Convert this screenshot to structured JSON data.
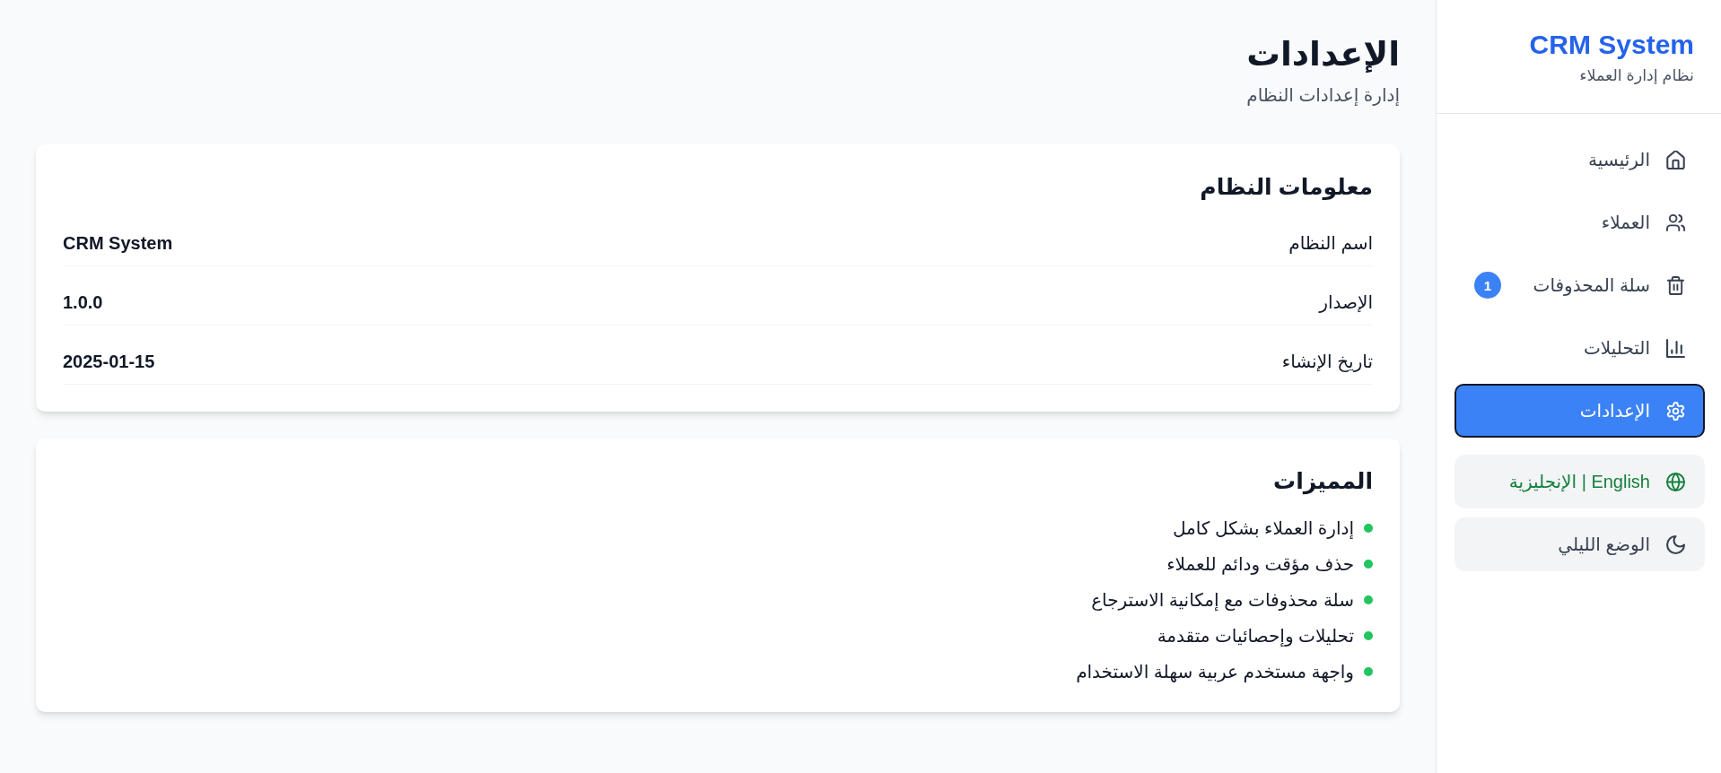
{
  "sidebar": {
    "title": "CRM System",
    "subtitle": "نظام إدارة العملاء",
    "nav_items": [
      {
        "label": "الرئيسية",
        "selected": false
      },
      {
        "label": "العملاء",
        "selected": false
      },
      {
        "label": "سلة المحذوفات",
        "selected": false,
        "badge": "1"
      },
      {
        "label": "التحليلات",
        "selected": false
      },
      {
        "label": "الإعدادات",
        "selected": true
      }
    ],
    "language_button": {
      "label": "English | الإنجليزية"
    },
    "theme_button": {
      "label": "الوضع الليلي"
    }
  },
  "page_header": {
    "title": "الإعدادات",
    "subtitle": "إدارة إعدادات النظام"
  },
  "system_info": {
    "title": "معلومات النظام",
    "rows": [
      {
        "label": "اسم النظام",
        "value": "CRM System"
      },
      {
        "label": "الإصدار",
        "value": "1.0.0"
      },
      {
        "label": "تاريخ الإنشاء",
        "value": "2025-01-15"
      }
    ]
  },
  "features": {
    "title": "المميزات",
    "items": [
      "إدارة العملاء بشكل كامل",
      "حذف مؤقت ودائم للعملاء",
      "سلة محذوفات مع إمكانية الاسترجاع",
      "تحليلات وإحصائيات متقدمة",
      "واجهة مستخدم عربية سهلة الاستخدام"
    ]
  }
}
